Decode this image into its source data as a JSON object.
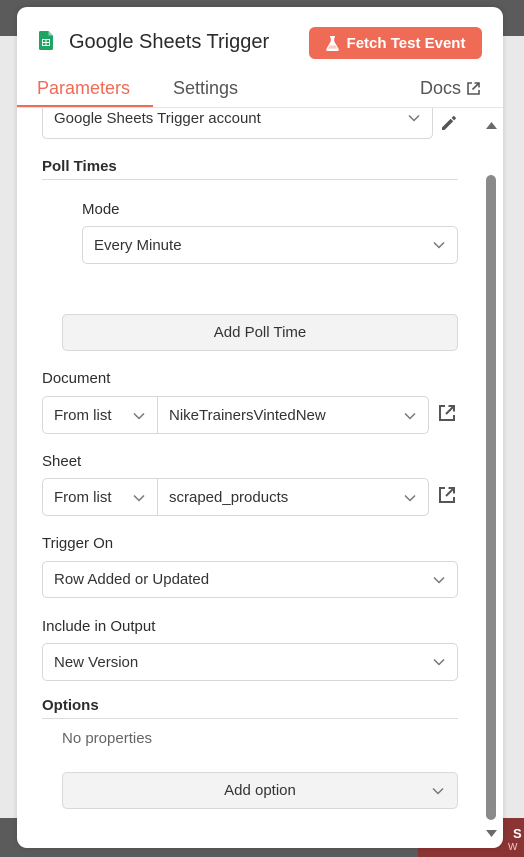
{
  "background": {
    "corner_line1": "S",
    "corner_line2": "W"
  },
  "header": {
    "title": "Google Sheets Trigger",
    "fetch_button_label": "Fetch Test Event",
    "app_icon": "google-sheets-icon",
    "fetch_icon": "flask-icon"
  },
  "tabs": [
    {
      "label": "Parameters",
      "active": true
    },
    {
      "label": "Settings",
      "active": false
    }
  ],
  "docs_label": "Docs",
  "credential": {
    "value": "Google Sheets Trigger account"
  },
  "poll_times": {
    "label": "Poll Times",
    "mode_label": "Mode",
    "mode_value": "Every Minute",
    "add_button": "Add Poll Time"
  },
  "document": {
    "label": "Document",
    "source": "From list",
    "value": "NikeTrainersVintedNew"
  },
  "sheet": {
    "label": "Sheet",
    "source": "From list",
    "value": "scraped_products"
  },
  "trigger_on": {
    "label": "Trigger On",
    "value": "Row Added or Updated"
  },
  "include_output": {
    "label": "Include in Output",
    "value": "New Version"
  },
  "options": {
    "label": "Options",
    "empty_text": "No properties",
    "add_button": "Add option"
  },
  "colors": {
    "accent": "#ef6b56",
    "sheets_green": "#1fa463",
    "scroll_thumb": "#8a8a8a"
  }
}
